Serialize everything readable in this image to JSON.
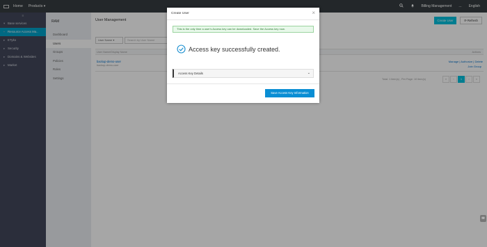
{
  "topbar": {
    "home": "Home",
    "products": "Products ▾",
    "billing": "Billing Management",
    "more": "...",
    "language": "English"
  },
  "leftnav": {
    "collapse": "≡",
    "items": [
      {
        "label": "Base services",
        "arrow": "▾"
      },
      {
        "label": "Resource Access Ma..",
        "arrow": ""
      },
      {
        "label": "ETyko",
        "arrow": "▸"
      },
      {
        "label": "Security",
        "arrow": "▸"
      },
      {
        "label": "Domains & Websites",
        "arrow": "▸"
      },
      {
        "label": "Market",
        "arrow": "▸"
      }
    ]
  },
  "subnav": {
    "title": "RAM",
    "items": [
      "Dashboard",
      "Users",
      "Groups",
      "Policies",
      "Roles",
      "Settings"
    ]
  },
  "main": {
    "title": "User Management",
    "create_label": "Create User",
    "refresh_label": "⟳ Refresh",
    "search_type": "User Name ▾",
    "search_placeholder": "Search by User Name",
    "table_head": "User Name/Display Name",
    "table_actions_head": "Actions",
    "row_name": "backup-demo-user",
    "row_display": "backup-demo-user",
    "row_actions": "Manage  |  Authorize  |  Delete",
    "row_actions2": "Join Group",
    "pager_text": "Total: 1 item(s) , Per Page: 10 item(s)",
    "pager": [
      "«",
      "‹",
      "1",
      "›",
      "»"
    ]
  },
  "modal": {
    "title": "Create User",
    "close": "×",
    "notice": "This is the only time a user's Access key can be downloaded. Save the Access key now.",
    "success_msg": "Access key successfully created.",
    "details_label": "Access Key Details",
    "save_label": "Save Access Key Information"
  },
  "colors": {
    "topbar": "#373d41",
    "leftnav": "#42485b",
    "accent": "#00c1de",
    "primary_button": "#0a8ed4",
    "success": "#1a8fd0"
  }
}
